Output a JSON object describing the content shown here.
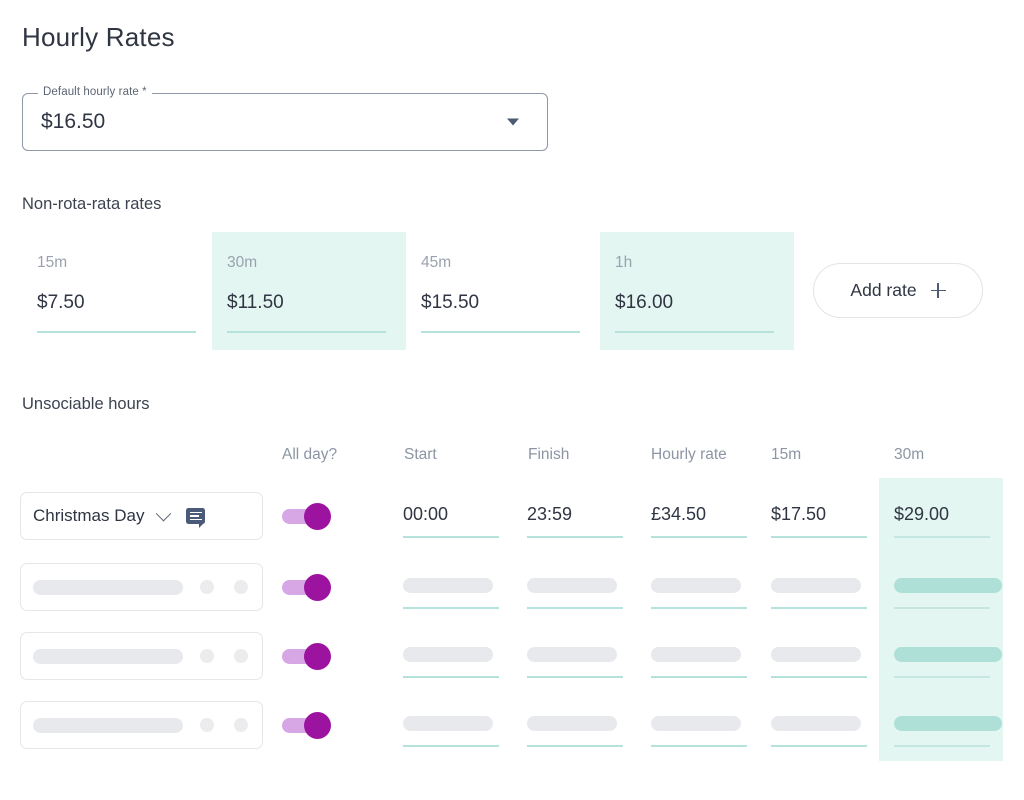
{
  "page": {
    "title": "Hourly Rates"
  },
  "default_rate": {
    "label": "Default hourly rate *",
    "value": "$16.50",
    "caret_icon": "chevron-down-icon"
  },
  "non_rota": {
    "title": "Non-rota-rata rates",
    "cells": [
      {
        "label": "15m",
        "value": "$7.50",
        "highlighted": false
      },
      {
        "label": "30m",
        "value": "$11.50",
        "highlighted": true
      },
      {
        "label": "45m",
        "value": "$15.50",
        "highlighted": false
      },
      {
        "label": "1h",
        "value": "$16.00",
        "highlighted": true
      }
    ],
    "add_button": {
      "label": "Add rate",
      "icon": "plus-icon"
    }
  },
  "unsociable": {
    "title": "Unsociable hours",
    "columns": [
      {
        "key": "all_day",
        "label": "All day?"
      },
      {
        "key": "start",
        "label": "Start"
      },
      {
        "key": "finish",
        "label": "Finish"
      },
      {
        "key": "hourly_rate",
        "label": "Hourly rate"
      },
      {
        "key": "m15",
        "label": "15m"
      },
      {
        "key": "m30",
        "label": "30m"
      }
    ],
    "highlighted_column": "30m",
    "rows": [
      {
        "day": "Christmas Day",
        "day_chevron_icon": "chevron-down-icon",
        "note_icon": "note-icon",
        "all_day_toggle": "on",
        "start": "00:00",
        "finish": "23:59",
        "hourly_rate": "£34.50",
        "m15": "$17.50",
        "m30": "$29.00",
        "loading": false
      },
      {
        "day": "",
        "all_day_toggle": "on",
        "start": "",
        "finish": "",
        "hourly_rate": "",
        "m15": "",
        "m30": "",
        "loading": true
      },
      {
        "day": "",
        "all_day_toggle": "on",
        "start": "",
        "finish": "",
        "hourly_rate": "",
        "m15": "",
        "m30": "",
        "loading": true
      },
      {
        "day": "",
        "all_day_toggle": "on",
        "start": "",
        "finish": "",
        "hourly_rate": "",
        "m15": "",
        "m30": "",
        "loading": true
      }
    ]
  },
  "colors": {
    "highlight_mint": "#e3f6f1",
    "underline_teal": "#b5e3dc",
    "toggle_knob_purple": "#9b139f",
    "toggle_track_purple": "#d7a6e4",
    "text_dark": "#2f3542",
    "text_muted": "#8c95a4",
    "note_icon_slate": "#4a5a78"
  }
}
